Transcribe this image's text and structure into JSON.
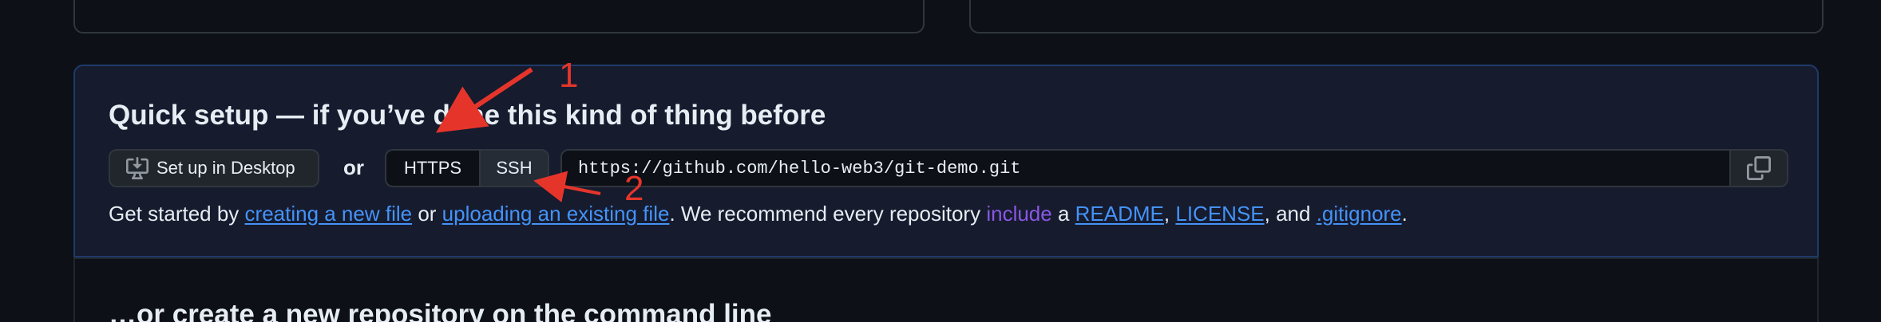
{
  "quick_setup": {
    "title": "Quick setup — if you’ve done this kind of thing before",
    "desktop_button": "Set up in Desktop",
    "or_label": "or",
    "protocols": [
      "HTTPS",
      "SSH"
    ],
    "selected_protocol": "SSH",
    "clone_url": "https://github.com/hello-web3/git-demo.git",
    "getting_started": {
      "prefix": "Get started by ",
      "link_new_file": "creating a new file",
      "or": " or ",
      "link_upload": "uploading an existing file",
      "middle": ". We recommend every repository ",
      "include": "include",
      "a": " a ",
      "link_readme": "README",
      "comma1": ", ",
      "link_license": "LICENSE",
      "and": ", and ",
      "link_gitignore": ".gitignore",
      "end": "."
    }
  },
  "command_line": {
    "title": "…or create a new repository on the command line"
  },
  "annotations": {
    "label_1": "1",
    "label_2": "2",
    "color": "#e5352b"
  },
  "icons": {
    "desktop": "desktop-download-icon",
    "copy": "copy-icon"
  }
}
